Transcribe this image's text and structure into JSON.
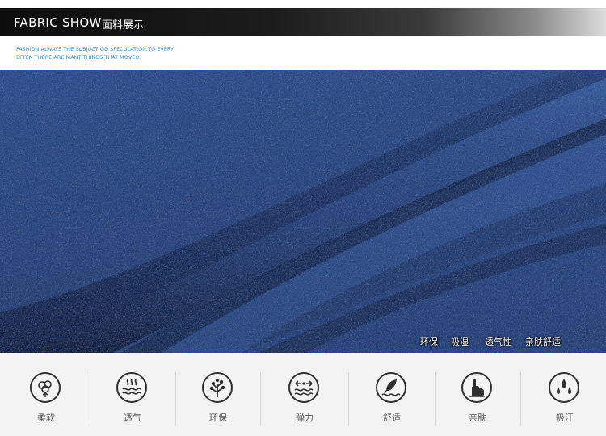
{
  "header": {
    "title": "FABRIC SHOW",
    "subtitle": "面料展示"
  },
  "tagline": {
    "line1": "FASHION ALWAYS THE  SUBJUCT OD SPECULATION.TO EVERY",
    "line2": "EFTEN THERE ARE MANT THINGS THAT MOVEO."
  },
  "fabric_overlay": [
    "环保",
    "吸湿",
    "透气性",
    "亲肤舒适"
  ],
  "features": [
    {
      "label": "柔软",
      "icon": "cotton-icon"
    },
    {
      "label": "透气",
      "icon": "airflow-icon"
    },
    {
      "label": "环保",
      "icon": "tree-icon"
    },
    {
      "label": "弹力",
      "icon": "stretch-icon"
    },
    {
      "label": "舒适",
      "icon": "feather-icon"
    },
    {
      "label": "亲肤",
      "icon": "hand-icon"
    },
    {
      "label": "吸汗",
      "icon": "droplets-icon"
    }
  ],
  "colors": {
    "header_dark": "#0d0d0d",
    "tagline": "#3d8ec8",
    "denim": "#2a4c8a",
    "icon_stroke": "#2f2f2f",
    "feature_bg": "#f3f3f3"
  }
}
